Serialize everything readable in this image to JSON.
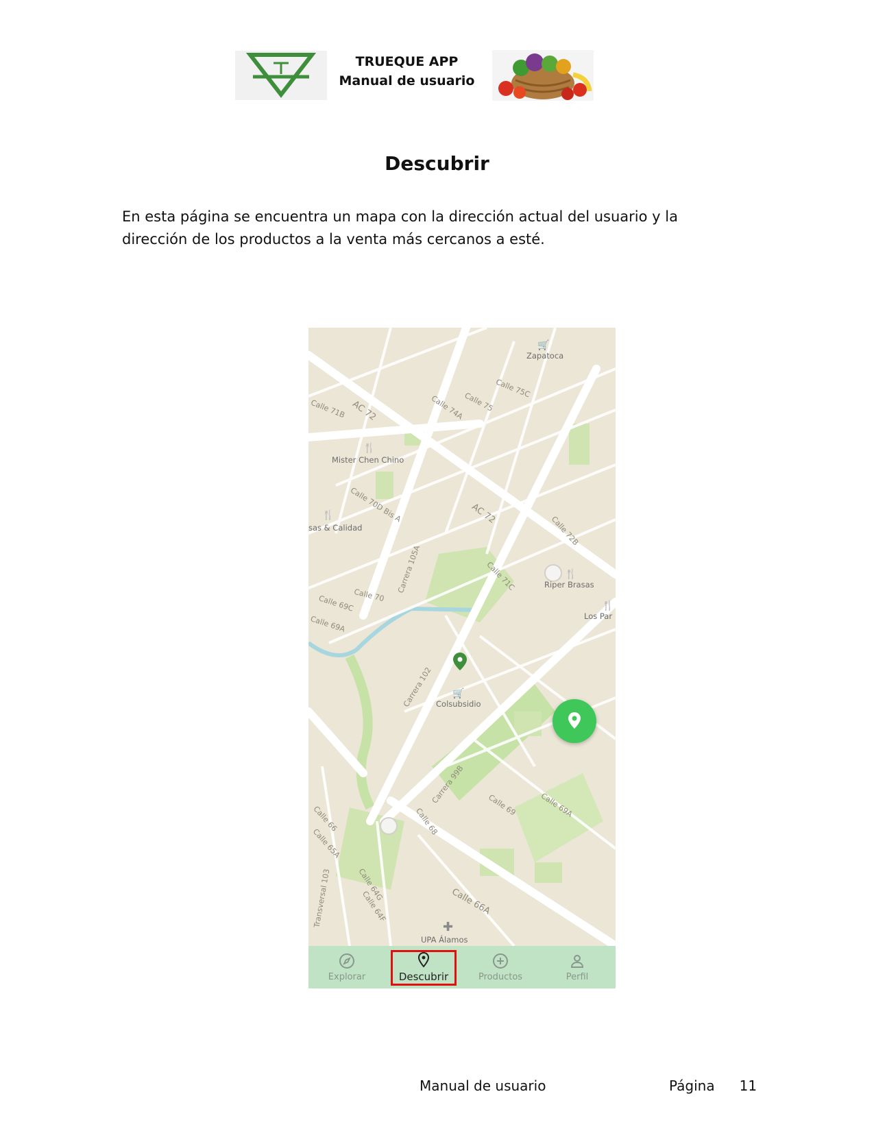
{
  "header": {
    "app_name": "TRUEQUE APP",
    "subtitle": "Manual de usuario",
    "logo_icon": "trueque-logo-icon",
    "basket_icon": "vegetable-basket-image"
  },
  "section_title": "Descubrir",
  "description": "En esta página se encuentra un mapa con la dirección actual del usuario y la dirección de los productos a la venta más cercanos a esté.",
  "screenshot": {
    "street_labels": [
      "Calle 75C",
      "Calle 74A",
      "Calle 75",
      "Calle 71B",
      "AC 72",
      "Calle 70D Bis A",
      "AC 72",
      "Calle 72B",
      "Calle 71C",
      "Calle 70",
      "Carrera 105A",
      "Calle 69C",
      "Calle 69A",
      "Carrera 102",
      "Carrera 99B",
      "Calle 69",
      "Calle 69A",
      "Calle 68",
      "Calle 66",
      "Calle 65A",
      "Calle 64G",
      "Calle 64F",
      "Calle 66A",
      "Transversal 103"
    ],
    "places": [
      "Zapatoca",
      "Mister Chen Chino",
      "sas & Calidad",
      "Riper Brasas",
      "Los Par",
      "Colsubsidio",
      "UPA Álamos"
    ],
    "nav": {
      "explorar": "Explorar",
      "descubrir": "Descubrir",
      "productos": "Productos",
      "perfil": "Perfil"
    },
    "active_tab_highlight": "#e01010",
    "accent": "#3fc75a"
  },
  "footer": {
    "left": "Manual de usuario",
    "page_label": "Página",
    "page_number": "11"
  }
}
